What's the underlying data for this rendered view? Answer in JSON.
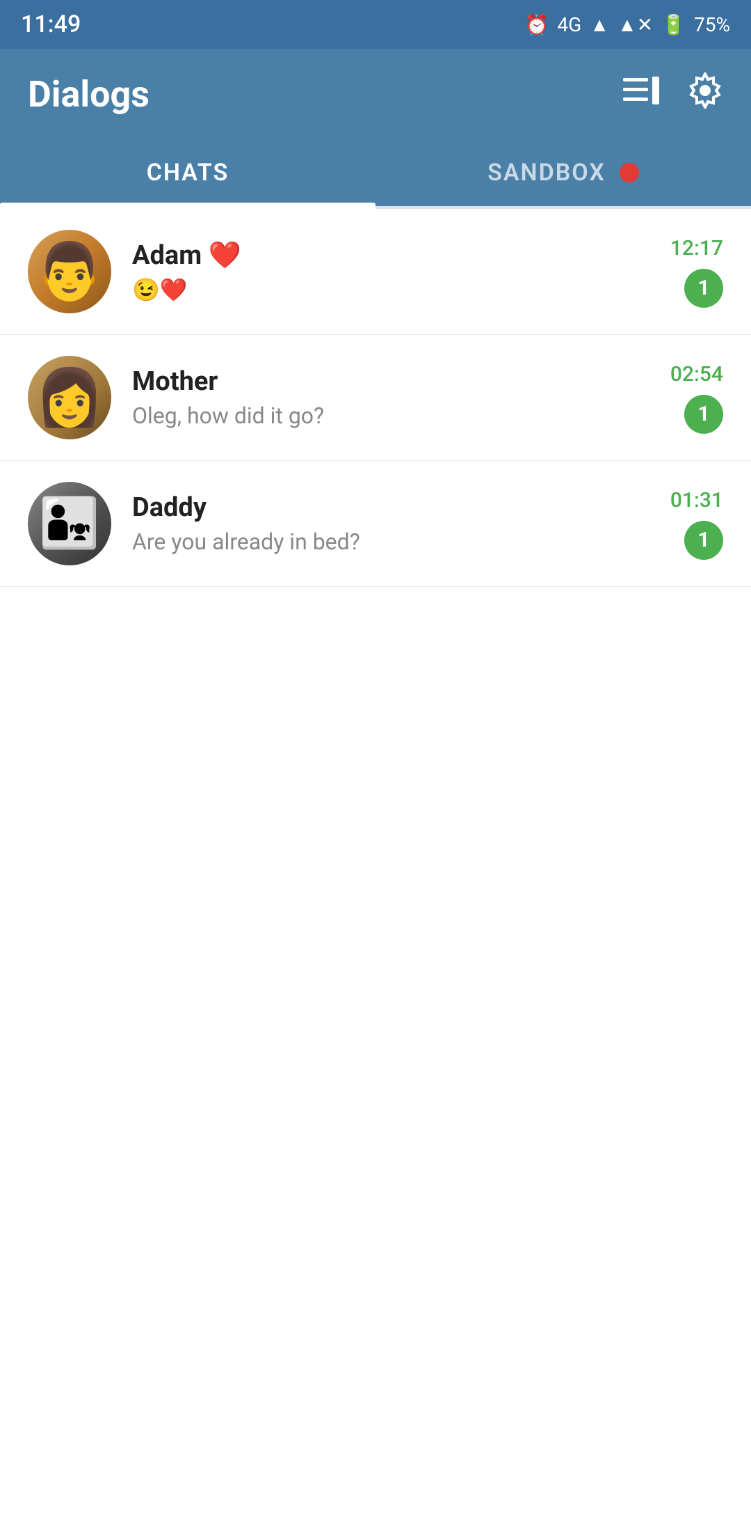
{
  "statusBar": {
    "time": "11:49",
    "battery": "75%",
    "network": "4G"
  },
  "header": {
    "title": "Dialogs",
    "newChatIcon": "compose-icon",
    "settingsIcon": "gear-icon"
  },
  "tabs": [
    {
      "id": "chats",
      "label": "CHATS",
      "active": true
    },
    {
      "id": "sandbox",
      "label": "SANDBOX",
      "active": false,
      "hasDot": true
    }
  ],
  "chats": [
    {
      "id": "adam",
      "name": "Adam ❤️",
      "preview": "😉❤️",
      "time": "12:17",
      "unread": 1
    },
    {
      "id": "mother",
      "name": "Mother",
      "preview": "Oleg, how did it go?",
      "time": "02:54",
      "unread": 1
    },
    {
      "id": "daddy",
      "name": "Daddy",
      "preview": "Are you already in bed?",
      "time": "01:31",
      "unread": 1
    }
  ]
}
